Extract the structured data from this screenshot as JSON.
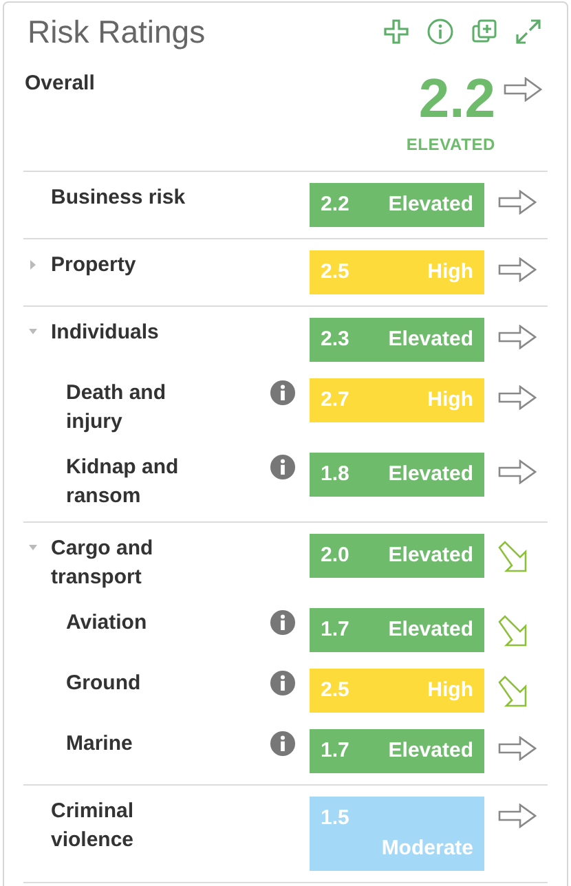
{
  "title": "Risk Ratings",
  "overall": {
    "label": "Overall",
    "score": "2.2",
    "level": "ELEVATED",
    "color": "#6dbb6b",
    "trend_down": false
  },
  "categories": [
    {
      "name": "Business risk",
      "score": "2.2",
      "level": "Elevated",
      "color": "#6dbb6b",
      "trend_down": false
    },
    {
      "name": "Property",
      "score": "2.5",
      "level": "High",
      "color": "#fddb3a",
      "trend_down": false,
      "expanded": false
    },
    {
      "name": "Individuals",
      "score": "2.3",
      "level": "Elevated",
      "color": "#6dbb6b",
      "trend_down": false,
      "expanded": true,
      "children": [
        {
          "name": "Death and injury",
          "score": "2.7",
          "level": "High",
          "color": "#fddb3a",
          "trend_down": false
        },
        {
          "name": "Kidnap and ransom",
          "score": "1.8",
          "level": "Elevated",
          "color": "#6dbb6b",
          "trend_down": false
        }
      ]
    },
    {
      "name": "Cargo and transport",
      "score": "2.0",
      "level": "Elevated",
      "color": "#6dbb6b",
      "trend_down": true,
      "expanded": true,
      "children": [
        {
          "name": "Aviation",
          "score": "1.7",
          "level": "Elevated",
          "color": "#6dbb6b",
          "trend_down": true
        },
        {
          "name": "Ground",
          "score": "2.5",
          "level": "High",
          "color": "#fddb3a",
          "trend_down": true
        },
        {
          "name": "Marine",
          "score": "1.7",
          "level": "Elevated",
          "color": "#6dbb6b",
          "trend_down": false
        }
      ]
    },
    {
      "name": "Criminal violence",
      "score": "1.5",
      "level": "Moderate",
      "color": "#a3d8f7",
      "trend_down": false
    }
  ]
}
